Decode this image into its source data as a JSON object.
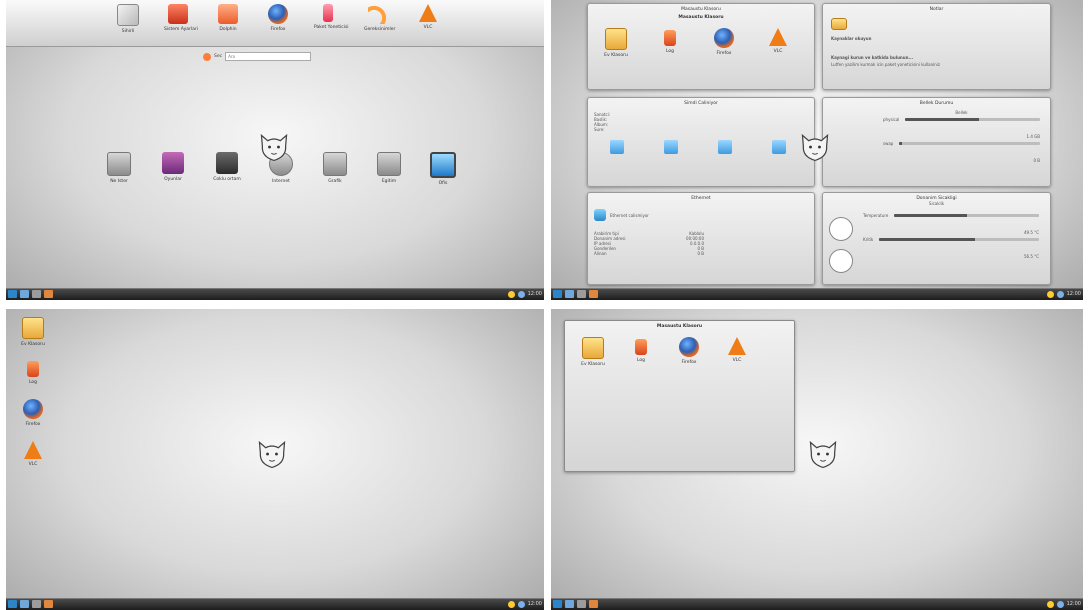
{
  "quad1": {
    "top_items": [
      {
        "label": "Sihirli",
        "icon": "tools-icon"
      },
      {
        "label": "Sistem Ayarlari",
        "icon": "settings-icon"
      },
      {
        "label": "Dolphin",
        "icon": "dolphin-icon"
      },
      {
        "label": "Firefox",
        "icon": "firefox-icon"
      },
      {
        "label": "Paket Yoneticisi",
        "icon": "package-icon"
      },
      {
        "label": "Gereksinimler",
        "icon": "curve-icon"
      },
      {
        "label": "VLC",
        "icon": "vlc-icon"
      }
    ],
    "search": {
      "label": "Sec",
      "placeholder": "Ara"
    },
    "categories": [
      {
        "label": "Ne Ister",
        "icon": "pin-icon"
      },
      {
        "label": "Oyunlar",
        "icon": "games-icon"
      },
      {
        "label": "Coklu ortam",
        "icon": "multimedia-icon"
      },
      {
        "label": "Internet",
        "icon": "internet-icon"
      },
      {
        "label": "Grafik",
        "icon": "graphic-icon"
      },
      {
        "label": "Egitim",
        "icon": "education-icon"
      },
      {
        "label": "Ofis",
        "icon": "office-icon"
      }
    ]
  },
  "quad2": {
    "folder_widget": {
      "title": "Masaustu Klasoru",
      "subtitle": "Masaustu Klasoru",
      "items": [
        {
          "label": "Ev Klasoru",
          "icon": "folder-icon"
        },
        {
          "label": "Log",
          "icon": "log-icon"
        },
        {
          "label": "Firefox",
          "icon": "firefox-icon"
        },
        {
          "label": "VLC",
          "icon": "vlc-icon"
        }
      ]
    },
    "notes_widget": {
      "title": "Notlar",
      "line1": "Kaynaklar okuyun",
      "line2": "Kaynagi kurun ve katkida bulunun...",
      "line3": "Lutfen yazilim kurmak icin paket yoneticisini kullaniniz"
    },
    "media_widget": {
      "title": "Simdi Caliniyor",
      "fields": [
        "Sanatci:",
        "Baslik:",
        "Album:",
        "Sure:"
      ]
    },
    "memory_widget": {
      "title": "Bellek Durumu",
      "col": "Bellek",
      "physical_label": "physical",
      "physical_value": "1.4 GB",
      "swap_label": "swap",
      "swap_value": "0 B",
      "physical_fraction": 0.55,
      "swap_fraction": 0.02
    },
    "network_widget": {
      "title": "Ethernet",
      "status": "Ethernet calismiyor",
      "rows": [
        {
          "k": "Arabirim tipi",
          "v": "Kablolu"
        },
        {
          "k": "Donanim adresi",
          "v": "00:00:00"
        },
        {
          "k": "IP adresi",
          "v": "0.0.0.0"
        },
        {
          "k": "Gonderilen",
          "v": "0 B"
        },
        {
          "k": "Alinan",
          "v": "0 B"
        }
      ]
    },
    "temp_widget": {
      "title": "Donanim Sicakligi",
      "header": "Sicaklik",
      "sensor1": "Temperature",
      "value1": "49.5 °C",
      "sensor2": "Kritik",
      "value2": "56.5 °C"
    }
  },
  "quad3": {
    "desktop_icons": [
      {
        "label": "Ev Klasoru",
        "icon": "folder-icon"
      },
      {
        "label": "Log",
        "icon": "log-icon"
      },
      {
        "label": "Firefox",
        "icon": "firefox-icon"
      },
      {
        "label": "VLC",
        "icon": "vlc-icon"
      }
    ]
  },
  "quad4": {
    "folder_view": {
      "title": "Masaustu Klasoru",
      "items": [
        {
          "label": "Ev Klasoru",
          "icon": "folder-icon"
        },
        {
          "label": "Log",
          "icon": "log-icon"
        },
        {
          "label": "Firefox",
          "icon": "firefox-icon"
        },
        {
          "label": "VLC",
          "icon": "vlc-icon"
        }
      ]
    }
  },
  "taskbar": {
    "clock": "12:00"
  },
  "colors": {
    "accent": "#2a86c9",
    "panel": "#1d1d1d",
    "desktop_light": "#f7f7f7",
    "desktop_dark": "#a9a9a9"
  }
}
